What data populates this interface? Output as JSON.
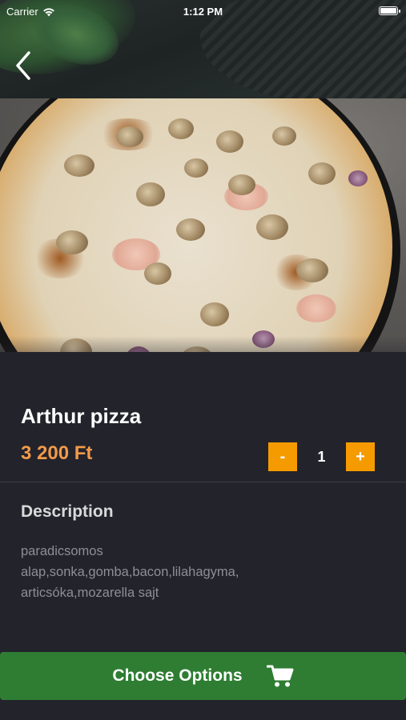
{
  "status_bar": {
    "carrier": "Carrier",
    "time": "1:12 PM"
  },
  "header": {
    "back_icon": "chevron-left-icon"
  },
  "product": {
    "name": "Arthur pizza",
    "price": "3 200 Ft",
    "quantity": "1",
    "minus_label": "-",
    "plus_label": "+"
  },
  "description": {
    "title": "Description",
    "lines": [
      "paradicsomos",
      "alap,sonka,gomba,bacon,lilahagyma,",
      "articsóka,mozarella sajt"
    ]
  },
  "action": {
    "label": "Choose Options",
    "icon": "cart-icon"
  },
  "colors": {
    "background": "#23232b",
    "price": "#f29a4a",
    "stepper": "#f59b00",
    "primary_button": "#2e7d32"
  }
}
